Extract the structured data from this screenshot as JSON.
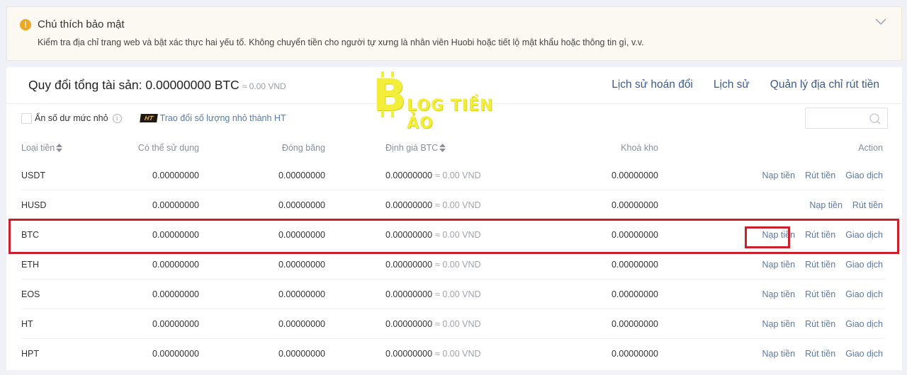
{
  "notice": {
    "icon": "warning-icon",
    "title": "Chú thích bảo mật",
    "text": "Kiểm tra địa chỉ trang web và bật xác thực hai yếu tố. Không chuyển tiền cho người tự xưng là nhân viên Huobi hoặc tiết lộ mật khẩu hoặc thông tin gì, v.v."
  },
  "header": {
    "total_label": "Quy đổi tổng tài sản: 0.00000000 BTC",
    "total_approx": "≈ 0.00 VND",
    "links": [
      "Lịch sử hoán đổi",
      "Lịch sử",
      "Quản lý địa chỉ rút tiền"
    ]
  },
  "watermark": {
    "b": "B",
    "text": "LOG TIỀN ẢO"
  },
  "filters": {
    "hide_small_label": "Ẩn số dư mức nhỏ",
    "hide_small_checked": false,
    "ht_badge": "HT",
    "convert_link": "Trao đổi số lượng nhỏ thành HT"
  },
  "search": {
    "placeholder": "",
    "value": ""
  },
  "table": {
    "headers": {
      "coin": "Loại tiền",
      "available": "Có thể sử dụng",
      "frozen": "Đóng băng",
      "btc_value": "Định giá BTC",
      "locked": "Khoá kho",
      "action": "Action"
    },
    "rows": [
      {
        "coin": "USDT",
        "available": "0.00000000",
        "frozen": "0.00000000",
        "btc": "0.00000000",
        "vnd": "≈ 0.00 VND",
        "locked": "0.00000000",
        "actions": [
          "Nạp tiền",
          "Rút tiền",
          "Giao dịch"
        ]
      },
      {
        "coin": "HUSD",
        "available": "0.00000000",
        "frozen": "0.00000000",
        "btc": "0.00000000",
        "vnd": "≈ 0.00 VND",
        "locked": "0.00000000",
        "actions": [
          "Nạp tiền",
          "Rút tiền"
        ]
      },
      {
        "coin": "BTC",
        "available": "0.00000000",
        "frozen": "0.00000000",
        "btc": "0.00000000",
        "vnd": "≈ 0.00 VND",
        "locked": "0.00000000",
        "actions": [
          "Nạp tiền",
          "Rút tiền",
          "Giao dịch"
        ]
      },
      {
        "coin": "ETH",
        "available": "0.00000000",
        "frozen": "0.00000000",
        "btc": "0.00000000",
        "vnd": "≈ 0.00 VND",
        "locked": "0.00000000",
        "actions": [
          "Nạp tiền",
          "Rút tiền",
          "Giao dịch"
        ]
      },
      {
        "coin": "EOS",
        "available": "0.00000000",
        "frozen": "0.00000000",
        "btc": "0.00000000",
        "vnd": "≈ 0.00 VND",
        "locked": "0.00000000",
        "actions": [
          "Nạp tiền",
          "Rút tiền",
          "Giao dịch"
        ]
      },
      {
        "coin": "HT",
        "available": "0.00000000",
        "frozen": "0.00000000",
        "btc": "0.00000000",
        "vnd": "≈ 0.00 VND",
        "locked": "0.00000000",
        "actions": [
          "Nạp tiền",
          "Rút tiền",
          "Giao dịch"
        ]
      },
      {
        "coin": "HPT",
        "available": "0.00000000",
        "frozen": "0.00000000",
        "btc": "0.00000000",
        "vnd": "≈ 0.00 VND",
        "locked": "0.00000000",
        "actions": [
          "Nạp tiền",
          "Rút tiền",
          "Giao dịch"
        ]
      }
    ]
  },
  "colors": {
    "link": "#5c7aa6",
    "highlight": "#cc1f2c",
    "warning": "#f0a824"
  }
}
